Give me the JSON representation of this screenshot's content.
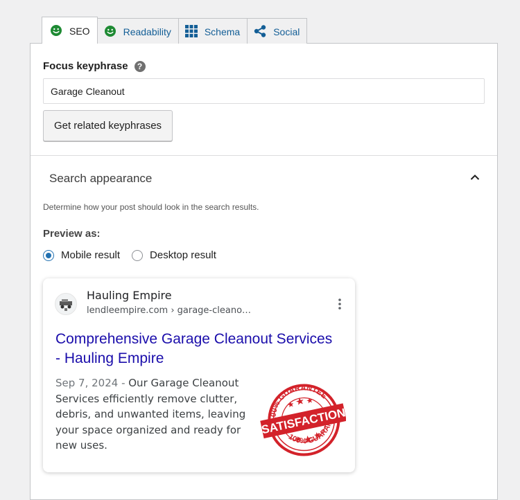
{
  "tabs": [
    {
      "label": "SEO",
      "icon": "smiley-icon",
      "active": true
    },
    {
      "label": "Readability",
      "icon": "smiley-icon",
      "active": false
    },
    {
      "label": "Schema",
      "icon": "grid-icon",
      "active": false
    },
    {
      "label": "Social",
      "icon": "share-icon",
      "active": false
    }
  ],
  "focus_keyphrase": {
    "label": "Focus keyphrase",
    "help_icon": "?",
    "value": "Garage Cleanout",
    "button_label": "Get related keyphrases"
  },
  "search_appearance": {
    "header": "Search appearance",
    "description": "Determine how your post should look in the search results.",
    "preview_label": "Preview as:",
    "options": [
      {
        "label": "Mobile result",
        "checked": true
      },
      {
        "label": "Desktop result",
        "checked": false
      }
    ]
  },
  "result": {
    "site_name": "Hauling Empire",
    "url": "lendleempire.com › garage-cleano…",
    "title": "Comprehensive Garage Cleanout Services - Hauling Empire",
    "date": "Sep 7, 2024",
    "date_separator": " - ",
    "snippet": "Our Garage Cleanout Services efficiently remove clutter, debris, and unwanted items, leaving your space organized and ready for new uses.",
    "seal_text_top": "100% GUARANTEE",
    "seal_text_main": "SATISFACTION",
    "seal_text_bottom": "100% GUARANTEE"
  },
  "colors": {
    "smiley_green": "#1e8a33",
    "link_blue": "#1a0dab",
    "tab_blue": "#135e96",
    "seal_red": "#d3222a"
  }
}
